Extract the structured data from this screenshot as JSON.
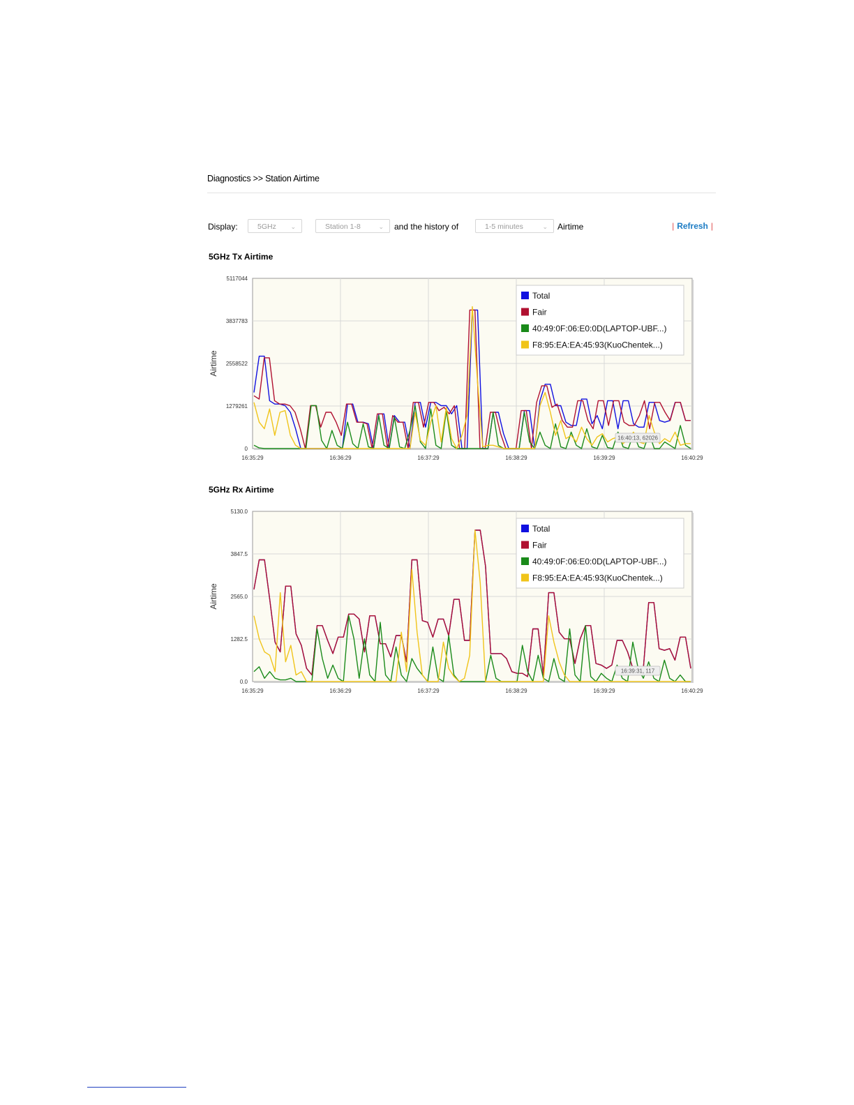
{
  "breadcrumb": "Diagnostics >> Station Airtime",
  "controls": {
    "display_label": "Display:",
    "band_select": "5GHz",
    "station_select": "Station 1-8",
    "history_label": "and the history of",
    "time_select": "1-5 minutes",
    "airtime_label": "Airtime",
    "refresh_label": "Refresh",
    "separator": "|"
  },
  "colors": {
    "total": "#1010e0",
    "fair": "#b01030",
    "station1": "#1a8a1a",
    "station2": "#f0c41a",
    "refresh": "#1d7cc4"
  },
  "icons": {
    "select_arrow": "chevron-down-icon"
  },
  "charts": [
    {
      "title": "5GHz Tx Airtime",
      "tooltip": "16:40:13, 62026"
    },
    {
      "title": "5GHz Rx Airtime",
      "tooltip": "16:39:31, 117"
    }
  ],
  "chart_data": [
    {
      "type": "line",
      "title": "5GHz Tx Airtime",
      "ylabel": "Airtime",
      "ylim": [
        0,
        5117044
      ],
      "yticks": [
        "0",
        "1279261",
        "2558522",
        "3837783",
        "5117044"
      ],
      "xticks": [
        "16:35:29",
        "16:36:29",
        "16:37:29",
        "16:38:29",
        "16:39:29",
        "16:40:29"
      ],
      "grid": true,
      "legend_position": "top-right",
      "series": [
        {
          "name": "Total",
          "color": "#1010e0",
          "values": [
            1700000,
            2800000,
            2800000,
            1450000,
            1350000,
            1350000,
            1300000,
            1100000,
            600000,
            0,
            0,
            0,
            0,
            0,
            0,
            0,
            0,
            0,
            1350000,
            1350000,
            800000,
            800000,
            750000,
            0,
            1050000,
            1050000,
            0,
            1000000,
            800000,
            800000,
            0,
            1400000,
            1400000,
            650000,
            1400000,
            1400000,
            1300000,
            1300000,
            1050000,
            1300000,
            0,
            0,
            4200000,
            4200000,
            0,
            0,
            1100000,
            1100000,
            450000,
            0,
            0,
            0,
            1150000,
            1150000,
            0,
            1450000,
            1950000,
            1950000,
            1300000,
            1300000,
            800000,
            700000,
            700000,
            1500000,
            1500000,
            750000,
            1000000,
            600000,
            1450000,
            1450000,
            600000,
            1450000,
            1450000,
            750000,
            650000,
            650000,
            1400000,
            1400000,
            850000,
            800000,
            850000,
            1400000,
            1400000,
            850000,
            850000
          ]
        },
        {
          "name": "Fair",
          "color": "#b01030",
          "values": [
            1600000,
            1500000,
            2750000,
            2750000,
            1450000,
            1350000,
            1350000,
            1300000,
            1100000,
            600000,
            0,
            1300000,
            1300000,
            650000,
            1100000,
            1100000,
            800000,
            400000,
            1350000,
            1350000,
            800000,
            800000,
            750000,
            0,
            1050000,
            1050000,
            0,
            1000000,
            800000,
            800000,
            0,
            1400000,
            1400000,
            650000,
            1400000,
            1400000,
            1150000,
            1250000,
            1050000,
            1300000,
            0,
            0,
            4200000,
            4200000,
            0,
            0,
            1100000,
            1100000,
            450000,
            0,
            0,
            0,
            1150000,
            1150000,
            0,
            1400000,
            1900000,
            1900000,
            1250000,
            1350000,
            850000,
            650000,
            650000,
            1450000,
            1450000,
            850000,
            600000,
            1450000,
            1450000,
            700000,
            1450000,
            1450000,
            800000,
            700000,
            700000,
            1000000,
            1450000,
            600000,
            1400000,
            1400000,
            1100000,
            850000,
            1400000,
            1400000,
            850000,
            850000
          ]
        },
        {
          "name": "40:49:0F:06:E0:0D(LAPTOP-UBF...)",
          "color": "#1a8a1a",
          "values": [
            100000,
            20000,
            0,
            0,
            0,
            0,
            0,
            0,
            0,
            0,
            0,
            1300000,
            1300000,
            250000,
            0,
            550000,
            100000,
            0,
            800000,
            150000,
            0,
            750000,
            50000,
            0,
            1000000,
            100000,
            0,
            950000,
            50000,
            0,
            550000,
            1300000,
            200000,
            0,
            1200000,
            100000,
            0,
            1150000,
            100000,
            0,
            0,
            0,
            0,
            0,
            0,
            0,
            1100000,
            100000,
            0,
            0,
            0,
            0,
            1100000,
            200000,
            0,
            500000,
            100000,
            0,
            750000,
            50000,
            0,
            500000,
            100000,
            0,
            600000,
            50000,
            0,
            400000,
            30000,
            0,
            500000,
            50000,
            0,
            450000,
            50000,
            0,
            450000,
            0,
            0,
            200000,
            100000,
            0,
            700000,
            100000,
            0
          ]
        },
        {
          "name": "F8:95:EA:EA:45:93(KuoChentek...)",
          "color": "#f0c41a",
          "values": [
            1400000,
            800000,
            600000,
            1200000,
            400000,
            1100000,
            1150000,
            400000,
            100000,
            0,
            0,
            0,
            0,
            0,
            0,
            0,
            0,
            0,
            0,
            0,
            0,
            0,
            0,
            0,
            0,
            0,
            0,
            0,
            0,
            0,
            0,
            1100000,
            250000,
            100000,
            800000,
            1300000,
            200000,
            1250000,
            300000,
            0,
            400000,
            1000000,
            4300000,
            2000000,
            50000,
            100000,
            100000,
            50000,
            0,
            0,
            0,
            0,
            0,
            0,
            0,
            1300000,
            1700000,
            1100000,
            400000,
            850000,
            300000,
            400000,
            200000,
            650000,
            300000,
            100000,
            350000,
            450000,
            200000,
            300000,
            350000,
            150000,
            300000,
            500000,
            200000,
            150000,
            1000000,
            500000,
            150000,
            300000,
            200000,
            500000,
            100000,
            150000,
            150000
          ]
        }
      ]
    },
    {
      "type": "line",
      "title": "5GHz Rx Airtime",
      "ylabel": "Airtime",
      "ylim": [
        0,
        5130.0
      ],
      "yticks": [
        "0.0",
        "1282.5",
        "2565.0",
        "3847.5",
        "5130.0"
      ],
      "xticks": [
        "16:35:29",
        "16:36:29",
        "16:37:29",
        "16:38:29",
        "16:39:29",
        "16:40:29"
      ],
      "grid": true,
      "legend_position": "top-right",
      "series": [
        {
          "name": "Total",
          "color": "#1010e0",
          "values": [
            2800,
            3700,
            3700,
            2500,
            1200,
            900,
            2900,
            2900,
            1450,
            1100,
            400,
            200,
            1700,
            1700,
            1250,
            850,
            1350,
            1350,
            2050,
            2050,
            1900,
            900,
            2000,
            2000,
            1150,
            1150,
            750,
            1400,
            1400,
            600,
            3700,
            3700,
            1850,
            1800,
            1350,
            1900,
            1900,
            1400,
            2500,
            2500,
            1250,
            1250,
            4600,
            4600,
            3500,
            850,
            850,
            850,
            700,
            300,
            250,
            250,
            150,
            1600,
            1600,
            200,
            2700,
            2700,
            1500,
            1300,
            1300,
            550,
            1300,
            1700,
            1700,
            550,
            500,
            400,
            500,
            1250,
            1250,
            900,
            400,
            350,
            400,
            2400,
            2400,
            1000,
            950,
            1000,
            650,
            1350,
            1350,
            400
          ]
        },
        {
          "name": "Fair",
          "color": "#b01030",
          "values": [
            2800,
            3700,
            3700,
            2500,
            1200,
            900,
            2900,
            2900,
            1450,
            1100,
            400,
            200,
            1700,
            1700,
            1250,
            850,
            1350,
            1350,
            2050,
            2050,
            1900,
            900,
            2000,
            2000,
            1150,
            1150,
            750,
            1400,
            1400,
            600,
            3700,
            3700,
            1850,
            1800,
            1350,
            1900,
            1900,
            1400,
            2500,
            2500,
            1250,
            1250,
            4600,
            4600,
            3500,
            850,
            850,
            850,
            700,
            300,
            250,
            250,
            150,
            1600,
            1600,
            200,
            2700,
            2700,
            1500,
            1300,
            1300,
            550,
            1300,
            1700,
            1700,
            550,
            500,
            400,
            500,
            1250,
            1250,
            900,
            400,
            350,
            400,
            2400,
            2400,
            1000,
            950,
            1000,
            650,
            1350,
            1350,
            400
          ]
        },
        {
          "name": "40:49:0F:06:E0:0D(LAPTOP-UBF...)",
          "color": "#1a8a1a",
          "values": [
            300,
            450,
            100,
            300,
            100,
            50,
            50,
            100,
            0,
            0,
            0,
            0,
            1600,
            700,
            100,
            500,
            100,
            0,
            2000,
            1300,
            100,
            1300,
            200,
            0,
            1800,
            200,
            0,
            1050,
            200,
            0,
            700,
            400,
            200,
            0,
            1050,
            100,
            0,
            1400,
            200,
            0,
            0,
            0,
            0,
            0,
            0,
            800,
            100,
            0,
            0,
            0,
            0,
            1100,
            300,
            0,
            800,
            100,
            0,
            700,
            100,
            0,
            1600,
            200,
            0,
            1700,
            150,
            0,
            250,
            100,
            0,
            500,
            100,
            0,
            1200,
            400,
            100,
            600,
            100,
            0,
            650,
            100,
            0,
            200,
            0,
            0
          ]
        },
        {
          "name": "F8:95:EA:EA:45:93(KuoChentek...)",
          "color": "#f0c41a",
          "values": [
            2000,
            1300,
            900,
            800,
            300,
            2700,
            600,
            1100,
            200,
            300,
            0,
            0,
            0,
            0,
            0,
            0,
            0,
            0,
            0,
            0,
            0,
            0,
            0,
            0,
            0,
            0,
            0,
            0,
            1500,
            300,
            3400,
            1500,
            200,
            0,
            0,
            0,
            1200,
            400,
            150,
            0,
            100,
            800,
            4600,
            3000,
            0,
            0,
            0,
            0,
            0,
            0,
            0,
            0,
            0,
            0,
            0,
            0,
            2000,
            1200,
            600,
            200,
            0,
            0,
            0,
            0,
            0,
            0,
            0,
            0,
            0,
            0,
            0,
            0,
            0,
            0,
            0,
            0,
            0,
            0,
            0,
            0,
            0,
            0,
            0,
            0
          ]
        }
      ]
    }
  ]
}
